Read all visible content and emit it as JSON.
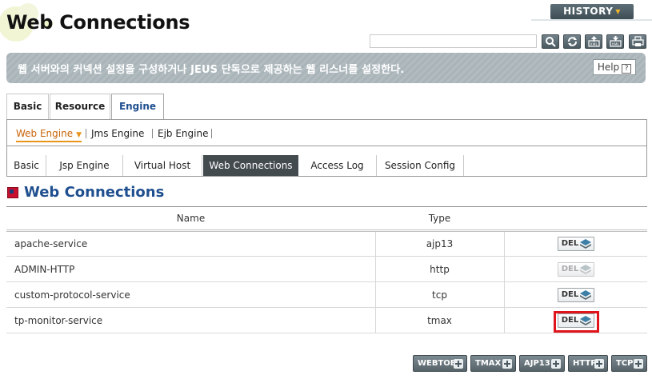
{
  "header": {
    "title": "Web Connections",
    "history_label": "HISTORY",
    "history_icon": "chevron-down-icon"
  },
  "toolbar": {
    "search_value": "",
    "icons": [
      "search-icon",
      "refresh-icon",
      "export-xml-icon",
      "import-xml-icon",
      "print-icon"
    ]
  },
  "description": {
    "text": "웹 서버와의 커넥션 설정을 구성하거나 JEUS 단독으로 제공하는 웹 리스너를 설정한다.",
    "help_label": "Help",
    "help_glyph": "?"
  },
  "tabs_level1": [
    {
      "label": "Basic",
      "active": false
    },
    {
      "label": "Resource",
      "active": false
    },
    {
      "label": "Engine",
      "active": true
    }
  ],
  "engine_tabs": [
    {
      "label": "Web Engine",
      "active": true
    },
    {
      "label": "Jms Engine",
      "active": false
    },
    {
      "label": "Ejb Engine",
      "active": false
    }
  ],
  "web_engine_tabs": [
    {
      "label": "Basic",
      "active": false
    },
    {
      "label": "Jsp Engine",
      "active": false
    },
    {
      "label": "Virtual Host",
      "active": false
    },
    {
      "label": "Web Connections",
      "active": true
    },
    {
      "label": "Access Log",
      "active": false
    },
    {
      "label": "Session Config",
      "active": false
    }
  ],
  "section": {
    "title": "Web Connections"
  },
  "table": {
    "columns": [
      "Name",
      "Type",
      ""
    ],
    "rows": [
      {
        "name": "apache-service",
        "type": "ajp13",
        "action": "DEL",
        "enabled": true
      },
      {
        "name": "ADMIN-HTTP",
        "type": "http",
        "action": "DEL",
        "enabled": false
      },
      {
        "name": "custom-protocol-service",
        "type": "tcp",
        "action": "DEL",
        "enabled": true
      },
      {
        "name": "tp-monitor-service",
        "type": "tmax",
        "action": "DEL",
        "enabled": true
      }
    ]
  },
  "add_buttons": [
    "WEBTOB",
    "TMAX",
    "AJP13",
    "HTTP",
    "TCP"
  ],
  "colors": {
    "accent_blue": "#1f4f8f",
    "active_orange": "#e8951a",
    "highlight_red": "#e0151b",
    "banner_gray": "#a9b4b9"
  }
}
